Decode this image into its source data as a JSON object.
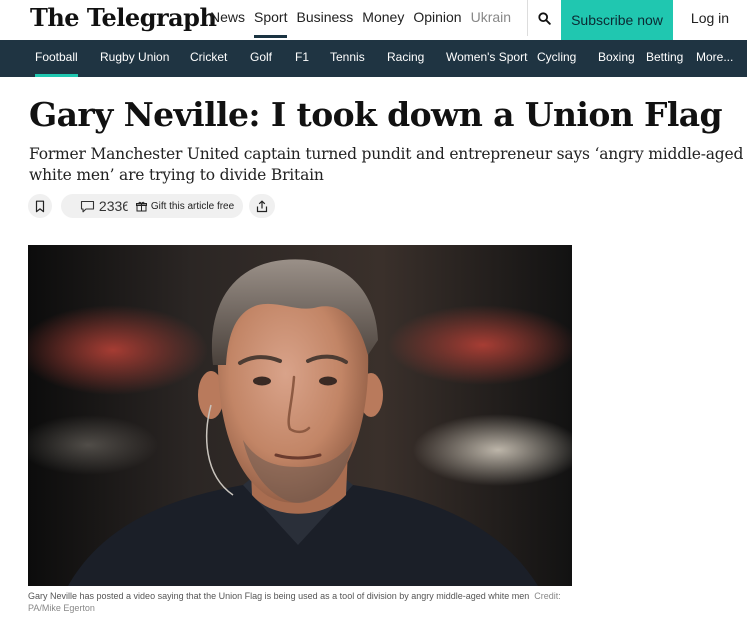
{
  "header": {
    "logo": "The Telegraph",
    "nav": [
      "News",
      "Sport",
      "Business",
      "Money",
      "Opinion",
      "Ukrain"
    ],
    "active_nav": "Sport",
    "subscribe": "Subscribe now",
    "login": "Log in",
    "icons": {
      "search": "search-icon"
    },
    "colors": {
      "subscribe_bg": "#20c7b0",
      "subnav_bg": "#1f3442"
    }
  },
  "subnav": {
    "items": [
      "Football",
      "Rugby Union",
      "Cricket",
      "Golf",
      "F1",
      "Tennis",
      "Racing",
      "Women's Sport",
      "Cycling",
      "Boxing",
      "Betting",
      "More..."
    ],
    "active": "Football"
  },
  "article": {
    "headline": "Gary Neville: I took down a Union Flag",
    "standfirst": "Former Manchester United captain turned pundit and entrepreneur says ‘angry middle-aged white men’ are trying to divide Britain",
    "actions": {
      "comments_count": "2336",
      "gift_label": "Gift this article free",
      "icons": [
        "bookmark-icon",
        "comment-icon",
        "gift-icon",
        "share-icon"
      ]
    },
    "image": {
      "caption": "Gary Neville has posted a video saying that the Union Flag is being used as a tool of division by angry middle-aged white men",
      "credit": "Credit: PA/Mike Egerton"
    }
  }
}
